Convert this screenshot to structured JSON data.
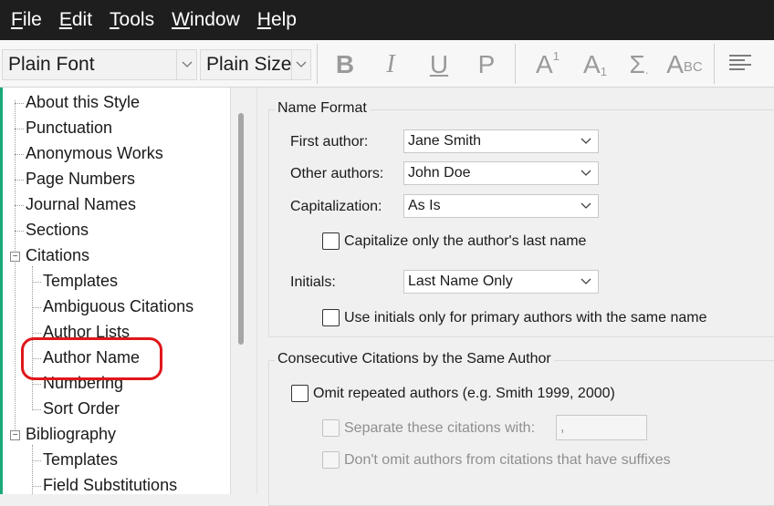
{
  "menu": [
    {
      "u": "F",
      "rest": "ile"
    },
    {
      "u": "E",
      "rest": "dit"
    },
    {
      "u": "T",
      "rest": "ools"
    },
    {
      "u": "W",
      "rest": "indow"
    },
    {
      "u": "H",
      "rest": "elp"
    }
  ],
  "toolbar": {
    "font": "Plain Font",
    "size": "Plain Size",
    "bold": "B",
    "italic": "I",
    "underline": "U",
    "plain": "P",
    "superscript_base": "A",
    "superscript_mark": "1",
    "subscript_base": "A",
    "subscript_mark": "1",
    "symbol": "Σ",
    "smallcaps_big": "A",
    "smallcaps_small": "BC"
  },
  "tree": [
    "About this Style",
    "Punctuation",
    "Anonymous Works",
    "Page Numbers",
    "Journal Names",
    "Sections",
    "Citations",
    "Templates",
    "Ambiguous Citations",
    "Author Lists",
    "Author Name",
    "Numbering",
    "Sort Order",
    "Bibliography",
    "Templates",
    "Field Substitutions"
  ],
  "name_format": {
    "title": "Name Format",
    "first_author_label": "First author:",
    "first_author_value": "Jane Smith",
    "other_authors_label": "Other authors:",
    "other_authors_value": "John Doe",
    "capitalization_label": "Capitalization:",
    "capitalization_value": "As Is",
    "cap_last_name": "Capitalize only the author's last name",
    "initials_label": "Initials:",
    "initials_value": "Last Name Only",
    "use_initials": "Use initials only for primary authors with the same name"
  },
  "consecutive": {
    "title": "Consecutive Citations by the Same Author",
    "omit_repeated": "Omit repeated authors (e.g. Smith 1999, 2000)",
    "separate_label": "Separate these citations with:",
    "separate_value": ",",
    "dont_omit": "Don't omit authors from citations that have suffixes"
  },
  "colors": {
    "menubar_bg": "#1e1e1e",
    "highlight_circle": "#e0161b",
    "accent_strip": "#1aa87a"
  }
}
